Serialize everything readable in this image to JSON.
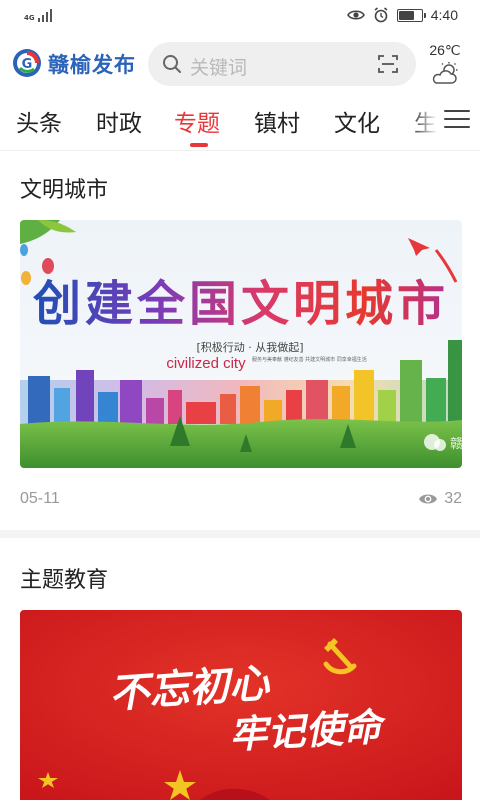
{
  "status_bar": {
    "network": "4G",
    "time": "4:40",
    "battery_level": 0.7
  },
  "header": {
    "brand": "赣榆发布",
    "search_placeholder": "关键词",
    "temperature": "26℃",
    "weather_icon": "partly-cloudy-icon"
  },
  "tabs": [
    "头条",
    "时政",
    "专题",
    "镇村",
    "文化",
    "生"
  ],
  "active_tab": "专题",
  "colors": {
    "brand_blue": "#2a63b8",
    "accent_red": "#e8373b",
    "muted_text": "#999999"
  },
  "articles": [
    {
      "title": "文明城市",
      "banner": {
        "headline": "创建全国文明城市",
        "slogan": "[积极行动 · 从我做起]",
        "english": "civilized city",
        "small_text": "服务与美奉献 遵纪友善 共建文明城市 同享幸福生活",
        "watermark": "赣"
      },
      "date": "05-11",
      "views": "32"
    },
    {
      "title": "主题教育",
      "banner": {
        "headline_line1": "不忘初心",
        "headline_line2": "牢记使命"
      }
    }
  ]
}
